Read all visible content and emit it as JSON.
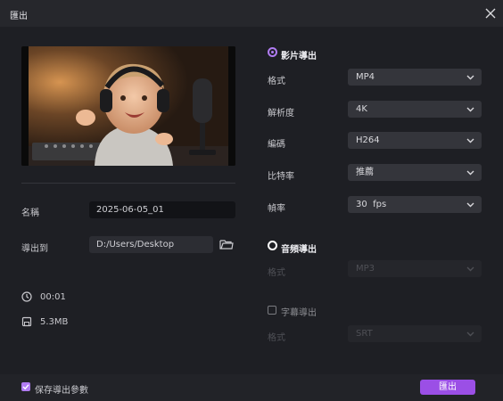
{
  "window": {
    "title": "匯出"
  },
  "output": {
    "name_label": "名稱",
    "name_value": "2025-06-05_01",
    "path_label": "導出到",
    "path_value": "D:/Users/Desktop",
    "duration": "00:01",
    "size": "5.3MB"
  },
  "video": {
    "section_label": "影片導出",
    "selected": true,
    "format": {
      "label": "格式",
      "value": "MP4"
    },
    "resolution": {
      "label": "解析度",
      "value": "4K"
    },
    "codec": {
      "label": "編碼",
      "value": "H264"
    },
    "bitrate": {
      "label": "比特率",
      "value": "推薦"
    },
    "framerate": {
      "label": "幀率",
      "value": "30  fps"
    }
  },
  "audio": {
    "section_label": "音頻導出",
    "selected": false,
    "format": {
      "label": "格式",
      "value": "MP3"
    }
  },
  "subtitle": {
    "section_label": "字幕導出",
    "checked": false,
    "format": {
      "label": "格式",
      "value": "SRT"
    }
  },
  "footer": {
    "save_params_label": "保存導出參數",
    "save_params_checked": true,
    "export_label": "匯出"
  },
  "colors": {
    "accent": "#b07cf2",
    "button": "#9b4fe6",
    "background": "#1e1f24"
  }
}
